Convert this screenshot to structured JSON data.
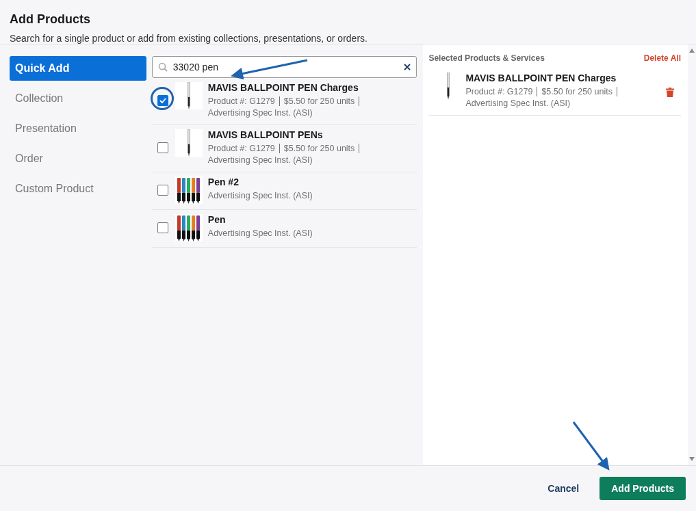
{
  "dialog": {
    "title": "Add Products",
    "subtitle": "Search for a single product or add from existing collections, presentations, or orders."
  },
  "nav": [
    {
      "label": "Quick Add",
      "selected": true
    },
    {
      "label": "Collection",
      "selected": false
    },
    {
      "label": "Presentation",
      "selected": false
    },
    {
      "label": "Order",
      "selected": false
    },
    {
      "label": "Custom Product",
      "selected": false
    }
  ],
  "search": {
    "value": "33020 pen"
  },
  "products": [
    {
      "name": "MAVIS BALLPOINT PEN Charges",
      "kind": "single",
      "checked": true,
      "circled": true,
      "details": [
        "Product #: G1279",
        "$5.50 for 250 units"
      ],
      "supplier": "Advertising Spec Inst. (ASI)"
    },
    {
      "name": "MAVIS BALLPOINT PENs",
      "kind": "single",
      "checked": false,
      "circled": false,
      "details": [
        "Product #: G1279",
        "$5.50 for 250 units"
      ],
      "supplier": "Advertising Spec Inst. (ASI)"
    },
    {
      "name": "Pen #2",
      "kind": "set",
      "checked": false,
      "circled": false,
      "supplier": "Advertising Spec Inst. (ASI)"
    },
    {
      "name": "Pen",
      "kind": "set",
      "checked": false,
      "circled": false,
      "supplier": "Advertising Spec Inst. (ASI)"
    }
  ],
  "selected_panel": {
    "heading": "Selected Products & Services",
    "delete_all": "Delete All",
    "items": [
      {
        "name": "MAVIS BALLPOINT PEN Charges",
        "kind": "single",
        "details": [
          "Product #: G1279",
          "$5.50 for 250 units"
        ],
        "supplier": "Advertising Spec Inst. (ASI)"
      }
    ]
  },
  "footer": {
    "cancel": "Cancel",
    "confirm": "Add Products"
  }
}
